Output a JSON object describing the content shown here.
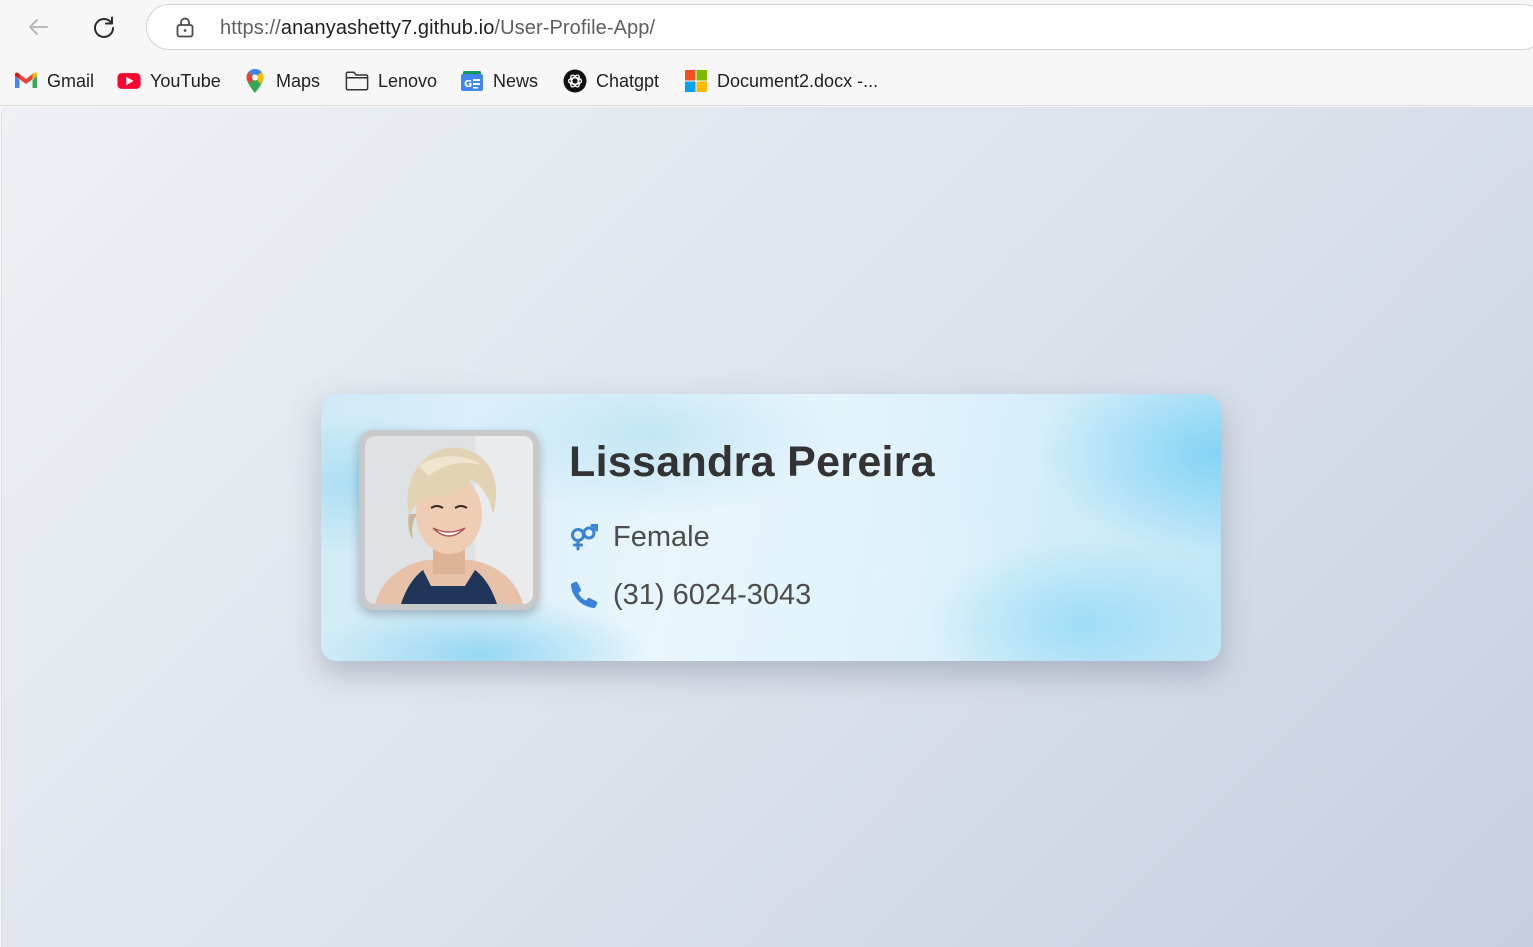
{
  "browser": {
    "url_scheme": "https://",
    "url_host": "ananyashetty7.github.io",
    "url_path": "/User-Profile-App/"
  },
  "bookmarks": [
    {
      "label": "Gmail",
      "icon": "gmail-icon"
    },
    {
      "label": "YouTube",
      "icon": "youtube-icon"
    },
    {
      "label": "Maps",
      "icon": "maps-icon"
    },
    {
      "label": "Lenovo",
      "icon": "folder-icon"
    },
    {
      "label": "News",
      "icon": "news-icon"
    },
    {
      "label": "Chatgpt",
      "icon": "chatgpt-icon"
    },
    {
      "label": "Document2.docx -...",
      "icon": "microsoft-icon"
    }
  ],
  "profile": {
    "name": "Lissandra Pereira",
    "gender": "Female",
    "phone": "(31) 6024-3043",
    "gender_icon": "gender-icon",
    "phone_icon": "phone-icon"
  },
  "colors": {
    "accent_icon": "#3b82d9",
    "name_text": "#333333",
    "info_text": "#4d4d4d"
  }
}
